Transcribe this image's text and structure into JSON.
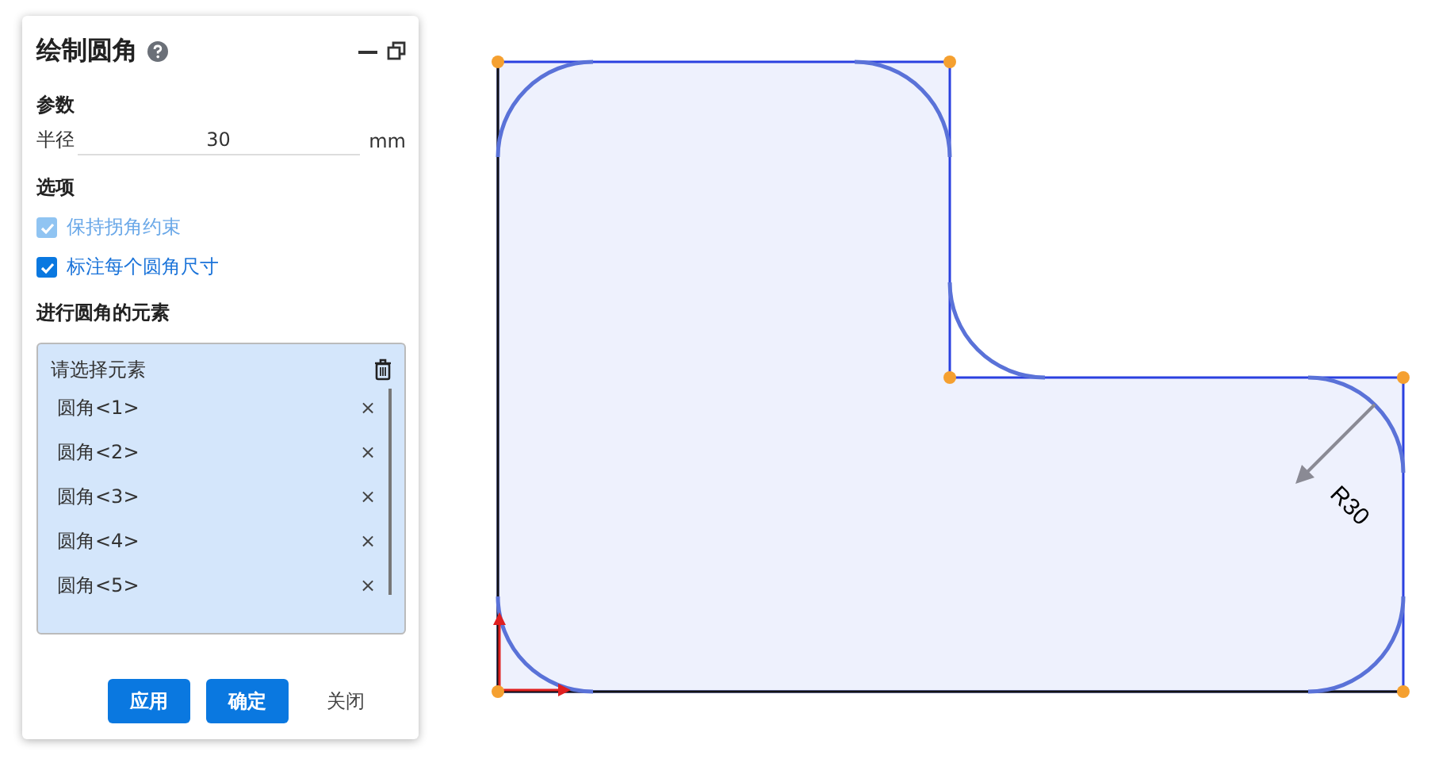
{
  "panel": {
    "title": "绘制圆角",
    "sections": [
      {
        "kind": "params",
        "heading": "参数",
        "field": {
          "label": "半径",
          "value": "30",
          "unit": "mm"
        }
      },
      {
        "kind": "options",
        "heading": "选项",
        "checkboxes": [
          {
            "label": "保持拐角约束",
            "checked": true,
            "disabled": true
          },
          {
            "label": "标注每个圆角尺寸",
            "checked": true,
            "disabled": false
          }
        ]
      },
      {
        "kind": "elements",
        "heading": "进行圆角的元素",
        "selection": {
          "placeholder": "请选择元素",
          "items": [
            {
              "label": "圆角<1>",
              "remove": "×"
            },
            {
              "label": "圆角<2>",
              "remove": "×"
            },
            {
              "label": "圆角<3>",
              "remove": "×"
            },
            {
              "label": "圆角<4>",
              "remove": "×"
            },
            {
              "label": "圆角<5>",
              "remove": "×"
            }
          ]
        }
      }
    ],
    "buttons": [
      {
        "label": "应用",
        "kind": "primary"
      },
      {
        "label": "确定",
        "kind": "primary"
      },
      {
        "label": "关闭",
        "kind": "plain"
      }
    ]
  },
  "drawing": {
    "dimension": "R30"
  }
}
